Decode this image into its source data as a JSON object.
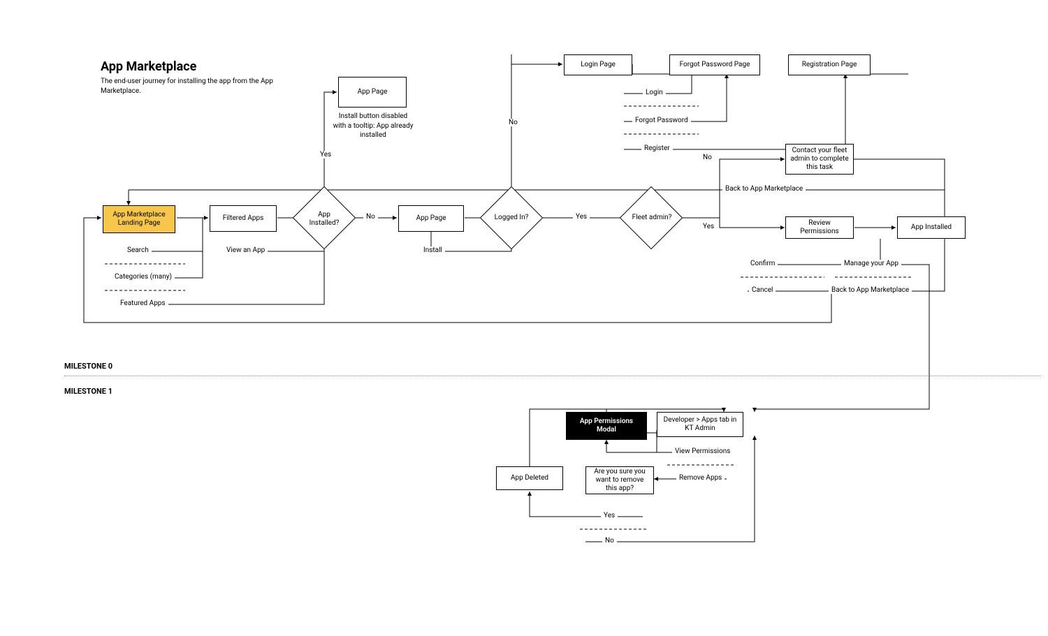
{
  "header": {
    "title": "App Marketplace",
    "description": "The end-user journey for installing the app from the App Marketplace."
  },
  "milestones": {
    "m0": "MILESTONE 0",
    "m1": "MILESTONE 1"
  },
  "nodes": {
    "landing": "App Marketplace Landing Page",
    "filtered": "Filtered Apps",
    "app_page_top": "App Page",
    "app_page_note": "Install button disabled with a tooltip: App already installed",
    "app_page_mid": "App Page",
    "login_page": "Login Page",
    "forgot_page": "Forgot Password Page",
    "reg_page": "Registration Page",
    "contact_admin": "Contact your fleet admin to complete this task",
    "review_perms": "Review Permissions",
    "app_installed": "App Installed",
    "perms_modal": "App Permissions Modal",
    "kt_admin": "Developer > Apps tab in KT Admin",
    "app_deleted": "App Deleted",
    "are_you_sure": "Are you sure you want to remove this app?"
  },
  "decisions": {
    "installed": "App\nInstalled?",
    "logged_in": "Logged In?",
    "fleet_admin": "Fleet admin?"
  },
  "labels": {
    "yes1": "Yes",
    "no1": "No",
    "no2": "No",
    "yes2": "Yes",
    "no3": "No",
    "yes3": "Yes",
    "search": "Search",
    "categories": "Categories (many)",
    "featured": "Featured Apps",
    "view_app": "View an App",
    "install": "Install",
    "login": "Login",
    "forgot": "Forgot Password",
    "register": "Register",
    "back_mkt_top": "Back to App Marketplace",
    "confirm": "Confirm",
    "cancel": "Cancel",
    "manage": "Manage your App",
    "back_mkt_bot": "Back to App Marketplace",
    "view_perms": "View Permissions",
    "remove_apps": "Remove Apps",
    "yes_m1": "Yes",
    "no_m1": "No"
  }
}
